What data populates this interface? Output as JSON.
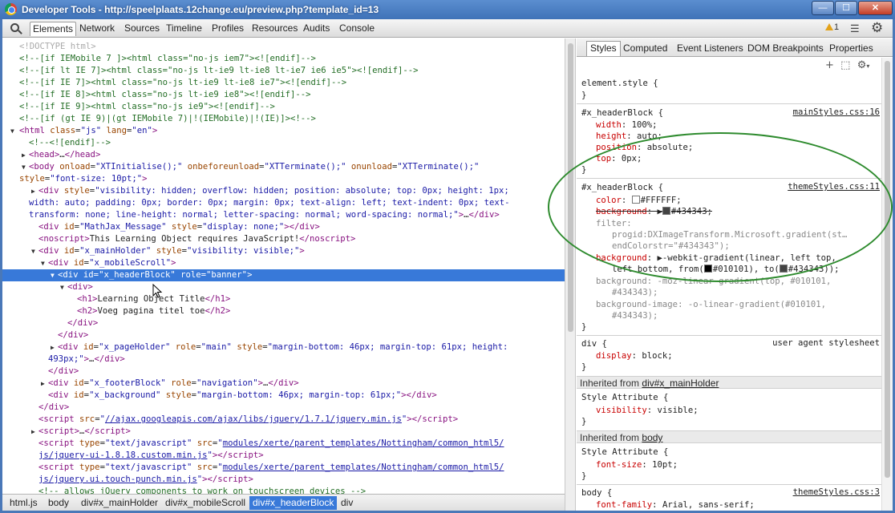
{
  "window": {
    "title": "Developer Tools - http://speelplaats.12change.eu/preview.php?template_id=13",
    "min": "—",
    "max": "☐",
    "close": "✕"
  },
  "toolbar": {
    "tabs": [
      "Elements",
      "Network",
      "Sources",
      "Timeline",
      "Profiles",
      "Resources",
      "Audits",
      "Console"
    ],
    "warnings": "1"
  },
  "dom": {
    "l0": "<!DOCTYPE html>",
    "l1": "<!--[if IEMobile 7 ]><html class=\"no-js iem7\"><![endif]-->",
    "l2": "<!--[if lt IE 7]><html class=\"no-js lt-ie9 lt-ie8 lt-ie7 ie6 ie5\"><![endif]-->",
    "l3": "<!--[if IE 7]><html class=\"no-js lt-ie9 lt-ie8 ie7\"><![endif]-->",
    "l4": "<!--[if IE 8]><html class=\"no-js lt-ie9 ie8\"><![endif]-->",
    "l5": "<!--[if IE 9]><html class=\"no-js ie9\"><![endif]-->",
    "l6": "<!--[if (gt IE 9)|(gt IEMobile 7)|!(IEMobile)|!(IE)]><!-->",
    "l8": "<!--<![endif]-->",
    "l20": "This Learning Object requires JavaScript!",
    "l26": "Learning Object Title",
    "l27": "Voeg pagina titel toe",
    "link1": "//ajax.googleapis.com/ajax/libs/jquery/1.7.1/jquery.min.js",
    "link2a": "modules/xerte/parent_templates/Nottingham/common_html5/",
    "link2b": "js/jquery-ui-1.8.18.custom.min.js",
    "link3a": "modules/xerte/parent_templates/Nottingham/common_html5/",
    "link3b": "js/jquery.ui.touch-punch.min.js",
    "comment_last": "<!-- allows jQuery components to work on touchscreen devices -->"
  },
  "styles_tabs": [
    "Styles",
    "Computed",
    "Event Listeners",
    "DOM Breakpoints",
    "Properties"
  ],
  "styles": {
    "element_style": "element.style {",
    "rule1_sel": "#x_headerBlock {",
    "rule1_src": "mainStyles.css:16",
    "rule1": [
      [
        "width",
        "100%;"
      ],
      [
        "height",
        "auto;"
      ],
      [
        "position",
        "absolute;"
      ],
      [
        "top",
        "0px;"
      ]
    ],
    "rule2_sel": "#x_headerBlock {",
    "rule2_src": "themeStyles.css:11",
    "color_val": "#FFFFFF;",
    "bg1_val": "#434343;",
    "filter_val1": "progid:DXImageTransform.Microsoft.gradient(st…",
    "filter_val2": "endColorstr=\"#434343\");",
    "bg2_val1": "-webkit-gradient(linear, left top,",
    "bg2_val2a": "left bottom, from(",
    "bg2_val2b": "#010101), to(",
    "bg2_val2c": "#434343));",
    "bg3_val1": "-moz-linear-gradient(top, #010101,",
    "bg3_val2": "#434343);",
    "bgimg_val1": "-o-linear-gradient(#010101,",
    "bgimg_val2": "#434343);",
    "div_sel": "div {",
    "div_src": "user agent stylesheet",
    "display_val": "block;",
    "inh1_label": "Inherited from",
    "inh1_link": "div#x_mainHolder",
    "style_attr": "Style Attribute {",
    "visibility_val": "visible;",
    "inh2_label": "Inherited from",
    "inh2_link": "body",
    "fontsize_val": "10pt;",
    "body_sel": "body {",
    "body_src": "themeStyles.css:3",
    "fontfamily_val": "Arial, sans-serif;"
  },
  "breadcrumbs": [
    "html.js",
    "body",
    "div#x_mainHolder",
    "div#x_mobileScroll",
    "div#x_headerBlock",
    "div"
  ],
  "colors": {
    "selection": "#3879d9",
    "annotation": "#2e8b2e"
  }
}
